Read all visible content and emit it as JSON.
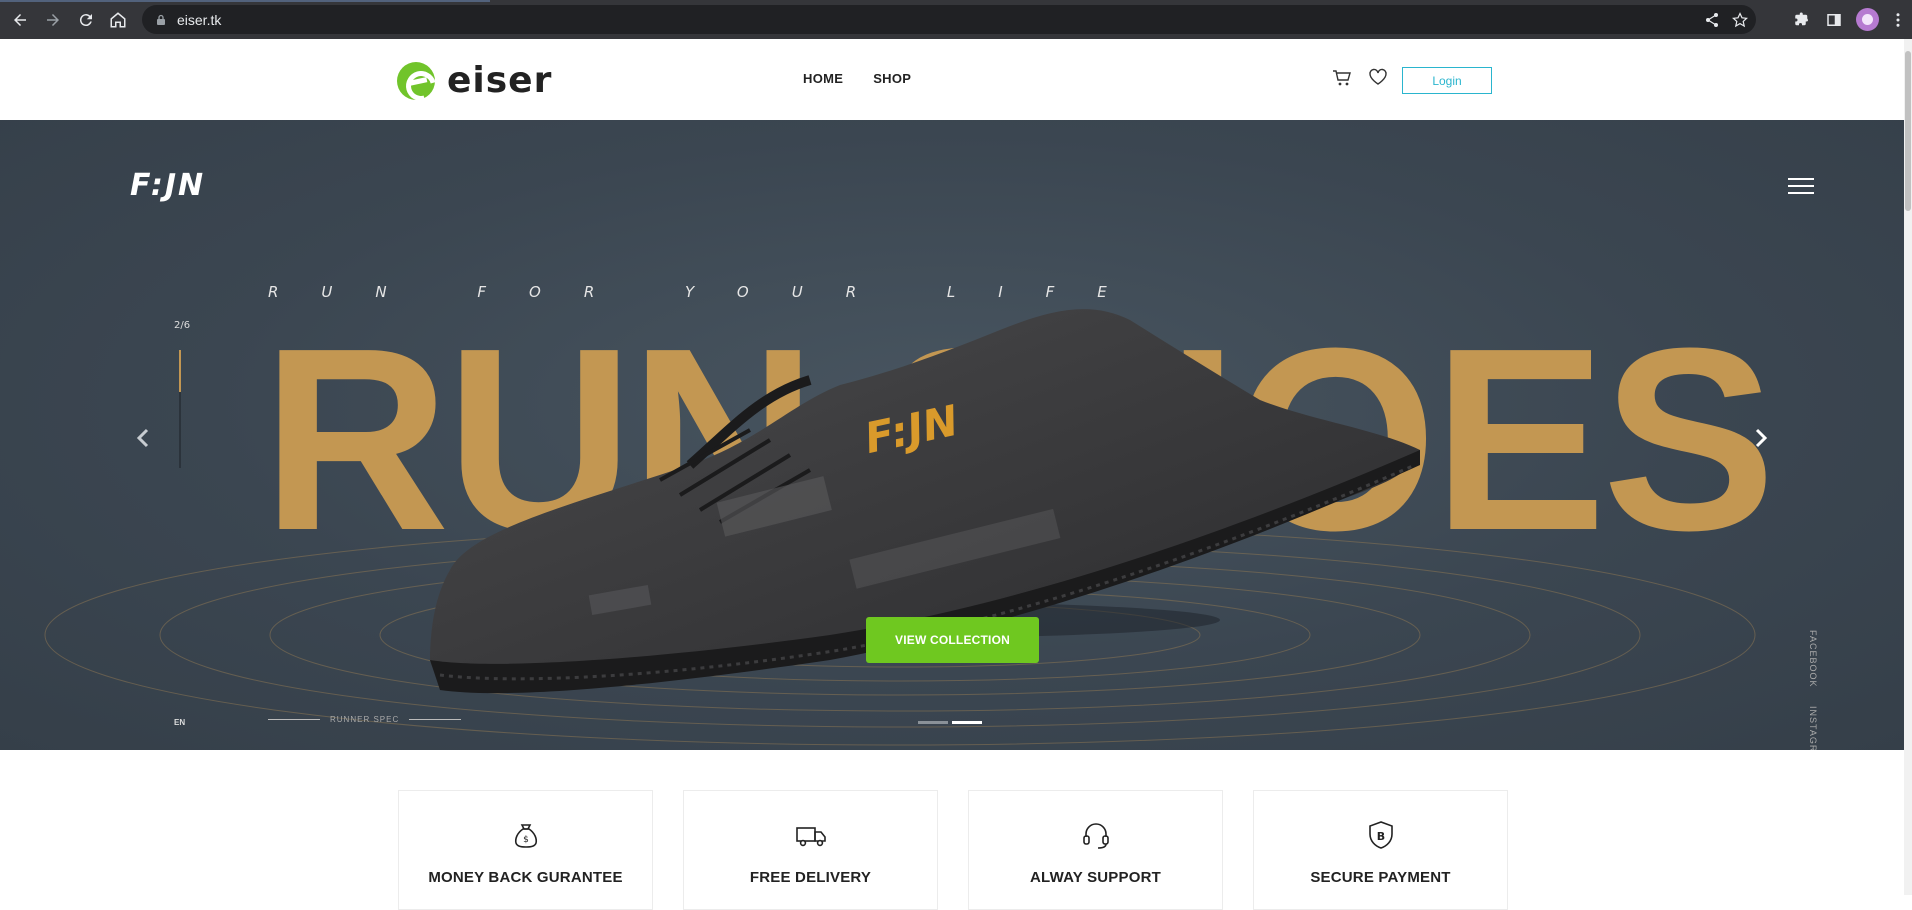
{
  "browser": {
    "url": "eiser.tk"
  },
  "header": {
    "logo_text": "eiser",
    "nav": [
      {
        "label": "HOME"
      },
      {
        "label": "SHOP"
      }
    ],
    "login_label": "Login"
  },
  "hero": {
    "brand": "F:JN",
    "tagline": "RUN FOR YOUR LIFE",
    "big_word": "RUN SHOES",
    "counter": "2/6",
    "cta_label": "VIEW COLLECTION",
    "lang": "EN",
    "runner_label": "RUNNER SPEC",
    "social": [
      "FACEBOOK",
      "INSTAGRAM"
    ],
    "slide_active": 2,
    "slide_count": 2
  },
  "features": [
    {
      "title": "MONEY BACK GURANTEE",
      "icon": "money-bag-icon"
    },
    {
      "title": "FREE DELIVERY",
      "icon": "truck-icon"
    },
    {
      "title": "ALWAY SUPPORT",
      "icon": "headset-icon"
    },
    {
      "title": "SECURE PAYMENT",
      "icon": "shield-bitcoin-icon"
    }
  ],
  "colors": {
    "accent_green": "#71c42b",
    "login_teal": "#2ab5ce",
    "hero_bg": "#3b4651",
    "hero_text_gold": "#c39752"
  }
}
